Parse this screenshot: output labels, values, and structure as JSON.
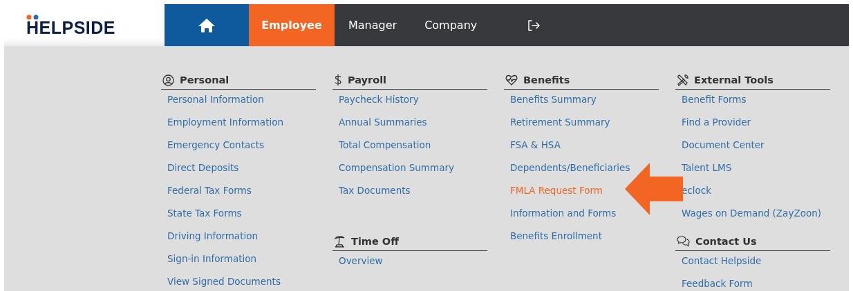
{
  "logo": {
    "text": "HELPSIDE"
  },
  "nav": {
    "tabs": [
      {
        "label": "Employee",
        "selected": true
      },
      {
        "label": "Manager",
        "selected": false
      },
      {
        "label": "Company",
        "selected": false
      }
    ]
  },
  "menu": {
    "columns": [
      {
        "sections": [
          {
            "title": "Personal",
            "items": [
              {
                "label": "Personal Information",
                "highlighted": false
              },
              {
                "label": "Employment Information",
                "highlighted": false
              },
              {
                "label": "Emergency Contacts",
                "highlighted": false
              },
              {
                "label": "Direct Deposits",
                "highlighted": false
              },
              {
                "label": "Federal Tax Forms",
                "highlighted": false
              },
              {
                "label": "State Tax Forms",
                "highlighted": false
              },
              {
                "label": "Driving Information",
                "highlighted": false
              },
              {
                "label": "Sign-in Information",
                "highlighted": false
              },
              {
                "label": "View Signed Documents",
                "highlighted": false
              }
            ]
          }
        ]
      },
      {
        "sections": [
          {
            "title": "Payroll",
            "items": [
              {
                "label": "Paycheck History",
                "highlighted": false
              },
              {
                "label": "Annual Summaries",
                "highlighted": false
              },
              {
                "label": "Total Compensation",
                "highlighted": false
              },
              {
                "label": "Compensation Summary",
                "highlighted": false
              },
              {
                "label": "Tax Documents",
                "highlighted": false
              }
            ]
          },
          {
            "title": "Time Off",
            "items": [
              {
                "label": "Overview",
                "highlighted": false
              }
            ]
          }
        ]
      },
      {
        "sections": [
          {
            "title": "Benefits",
            "items": [
              {
                "label": "Benefits Summary",
                "highlighted": false
              },
              {
                "label": "Retirement Summary",
                "highlighted": false
              },
              {
                "label": "FSA & HSA",
                "highlighted": false
              },
              {
                "label": "Dependents/Beneficiaries",
                "highlighted": false
              },
              {
                "label": "FMLA Request Form",
                "highlighted": true
              },
              {
                "label": "Information and Forms",
                "highlighted": false
              },
              {
                "label": "Benefits Enrollment",
                "highlighted": false
              }
            ]
          }
        ]
      },
      {
        "sections": [
          {
            "title": "External Tools",
            "items": [
              {
                "label": "Benefit Forms",
                "highlighted": false
              },
              {
                "label": "Find a Provider",
                "highlighted": false
              },
              {
                "label": "Document Center",
                "highlighted": false
              },
              {
                "label": "Talent LMS",
                "highlighted": false
              },
              {
                "label": "eclock",
                "highlighted": false
              },
              {
                "label": "Wages on Demand (ZayZoon)",
                "highlighted": false
              }
            ]
          },
          {
            "title": "Contact Us",
            "items": [
              {
                "label": "Contact Helpside",
                "highlighted": false
              },
              {
                "label": "Feedback Form",
                "highlighted": false
              }
            ]
          }
        ]
      }
    ]
  }
}
